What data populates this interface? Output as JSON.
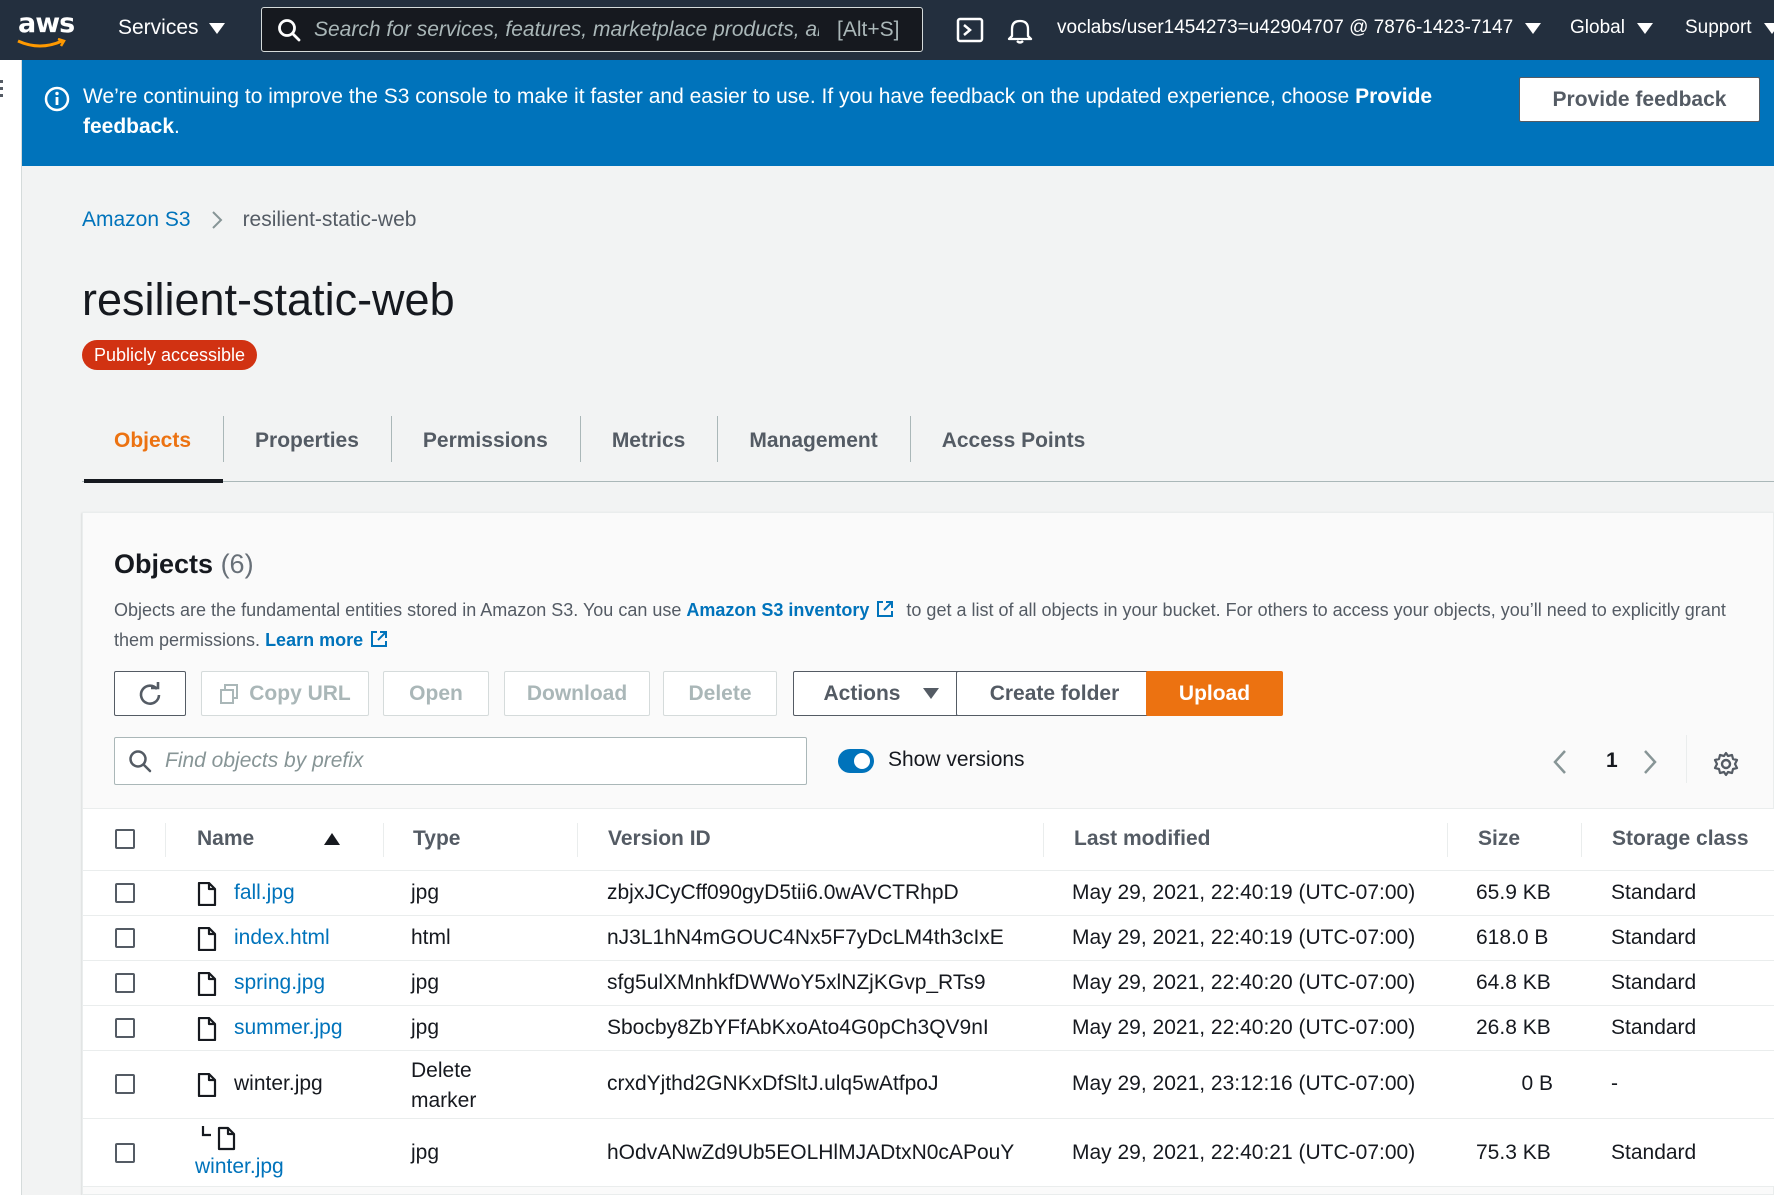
{
  "topnav": {
    "logo_text": "aws",
    "services_label": "Services",
    "search_placeholder": "Search for services, features, marketplace products, and docs",
    "search_shortcut": "[Alt+S]",
    "account": "voclabs/user1454273=u42904707 @ 7876-1423-7147",
    "region": "Global",
    "support": "Support"
  },
  "banner": {
    "message_prefix": "We’re continuing to improve the S3 console to make it faster and easier to use. If you have feedback on the updated experience, choose ",
    "message_bold": "Provide feedback",
    "message_suffix": ".",
    "button": "Provide feedback"
  },
  "breadcrumb": {
    "root": "Amazon S3",
    "current": "resilient-static-web"
  },
  "page": {
    "title": "resilient-static-web",
    "badge": "Publicly accessible"
  },
  "tabs": [
    {
      "label": "Objects",
      "active": true
    },
    {
      "label": "Properties"
    },
    {
      "label": "Permissions"
    },
    {
      "label": "Metrics"
    },
    {
      "label": "Management"
    },
    {
      "label": "Access Points"
    }
  ],
  "objects": {
    "heading": "Objects",
    "count": "(6)",
    "desc_1": "Objects are the fundamental entities stored in Amazon S3. You can use ",
    "desc_link": "Amazon S3 inventory",
    "desc_2": " to get a list of all objects in your bucket. For others to access your objects, you’ll need to explicitly grant them permissions. ",
    "learn_more": "Learn more",
    "buttons": {
      "copy_url": "Copy URL",
      "open": "Open",
      "download": "Download",
      "delete": "Delete",
      "actions": "Actions",
      "create_folder": "Create folder",
      "upload": "Upload"
    },
    "find_placeholder": "Find objects by prefix",
    "show_versions": "Show versions",
    "show_versions_on": true,
    "page": "1",
    "columns": [
      "Name",
      "Type",
      "Version ID",
      "Last modified",
      "Size",
      "Storage class"
    ],
    "rows": [
      {
        "name": "fall.jpg",
        "type": "jpg",
        "version": "zbjxJCyCff090gyD5tii6.0wAVCTRhpD",
        "modified": "May 29, 2021, 22:40:19 (UTC-07:00)",
        "size": "65.9 KB",
        "storage": "Standard"
      },
      {
        "name": "index.html",
        "type": "html",
        "version": "nJ3L1hN4mGOUC4Nx5F7yDcLM4th3cIxE",
        "modified": "May 29, 2021, 22:40:19 (UTC-07:00)",
        "size": "618.0 B",
        "storage": "Standard"
      },
      {
        "name": "spring.jpg",
        "type": "jpg",
        "version": "sfg5ulXMnhkfDWWoY5xlNZjKGvp_RTs9",
        "modified": "May 29, 2021, 22:40:20 (UTC-07:00)",
        "size": "64.8 KB",
        "storage": "Standard"
      },
      {
        "name": "summer.jpg",
        "type": "jpg",
        "version": "Sbocby8ZbYFfAbKxoAto4G0pCh3QV9nI",
        "modified": "May 29, 2021, 22:40:20 (UTC-07:00)",
        "size": "26.8 KB",
        "storage": "Standard"
      },
      {
        "name": "winter.jpg",
        "type_1": "Delete",
        "type_2": "marker",
        "version": "crxdYjthd2GNKxDfSltJ.ulq5wAtfpoJ",
        "modified": "May 29, 2021, 23:12:16 (UTC-07:00)",
        "size": "0 B",
        "storage": "-"
      },
      {
        "name": "winter.jpg",
        "type": "jpg",
        "version": "hOdvANwZd9Ub5EOLHlMJADtxN0cAPouY",
        "modified": "May 29, 2021, 22:40:21 (UTC-07:00)",
        "size": "75.3 KB",
        "storage": "Standard"
      }
    ]
  }
}
